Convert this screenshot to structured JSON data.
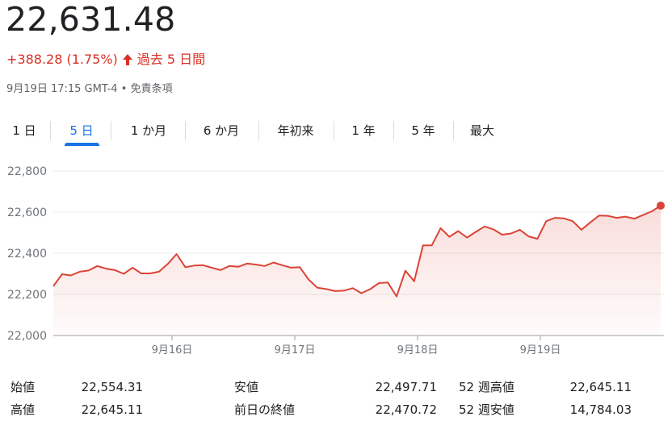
{
  "header": {
    "price": "22,631.48",
    "change": "+388.28 (1.75%)",
    "period": "過去 5 日間",
    "timestamp": "9月19日 17:15 GMT-4",
    "disclaimer": "免責条項",
    "change_color": "#d93025",
    "arrow_icon": "arrow-up-icon"
  },
  "tabs": [
    {
      "label": "1 日",
      "active": false
    },
    {
      "label": "5 日",
      "active": true
    },
    {
      "label": "1 か月",
      "active": false
    },
    {
      "label": "6 か月",
      "active": false
    },
    {
      "label": "年初来",
      "active": false
    },
    {
      "label": "1 年",
      "active": false
    },
    {
      "label": "5 年",
      "active": false
    },
    {
      "label": "最大",
      "active": false
    }
  ],
  "chart_data": {
    "type": "area",
    "title": "",
    "xlabel": "",
    "ylabel": "",
    "ylim": [
      22000,
      22800
    ],
    "yticks": [
      "22,800",
      "22,600",
      "22,400",
      "22,200",
      "22,000"
    ],
    "xticks": [
      "9月16日",
      "9月17日",
      "9月18日",
      "9月19日"
    ],
    "grid": true,
    "line_color": "#db4437",
    "series": [
      {
        "values": [
          22240,
          22298,
          22292,
          22310,
          22316,
          22338,
          22325,
          22318,
          22300,
          22330,
          22302,
          22302,
          22310,
          22348,
          22396,
          22332,
          22340,
          22342,
          22330,
          22318,
          22338,
          22334,
          22350,
          22345,
          22338,
          22355,
          22342,
          22330,
          22332,
          22272,
          22232,
          22226,
          22216,
          22218,
          22230,
          22206,
          22225,
          22255,
          22258,
          22190,
          22315,
          22264,
          22438,
          22438,
          22522,
          22480,
          22508,
          22476,
          22504,
          22530,
          22516,
          22490,
          22496,
          22514,
          22482,
          22470,
          22556,
          22572,
          22570,
          22556,
          22514,
          22550,
          22583,
          22582,
          22572,
          22578,
          22568,
          22586,
          22604,
          22631.48
        ]
      }
    ]
  },
  "stats": {
    "open_label": "始値",
    "open_value": "22,554.31",
    "high_label": "高値",
    "high_value": "22,645.11",
    "low_label": "安値",
    "low_value": "22,497.71",
    "prev_close_label": "前日の終値",
    "prev_close_value": "22,470.72",
    "wk52_high_label": "52 週高値",
    "wk52_high_value": "22,645.11",
    "wk52_low_label": "52 週安値",
    "wk52_low_value": "14,784.03"
  }
}
